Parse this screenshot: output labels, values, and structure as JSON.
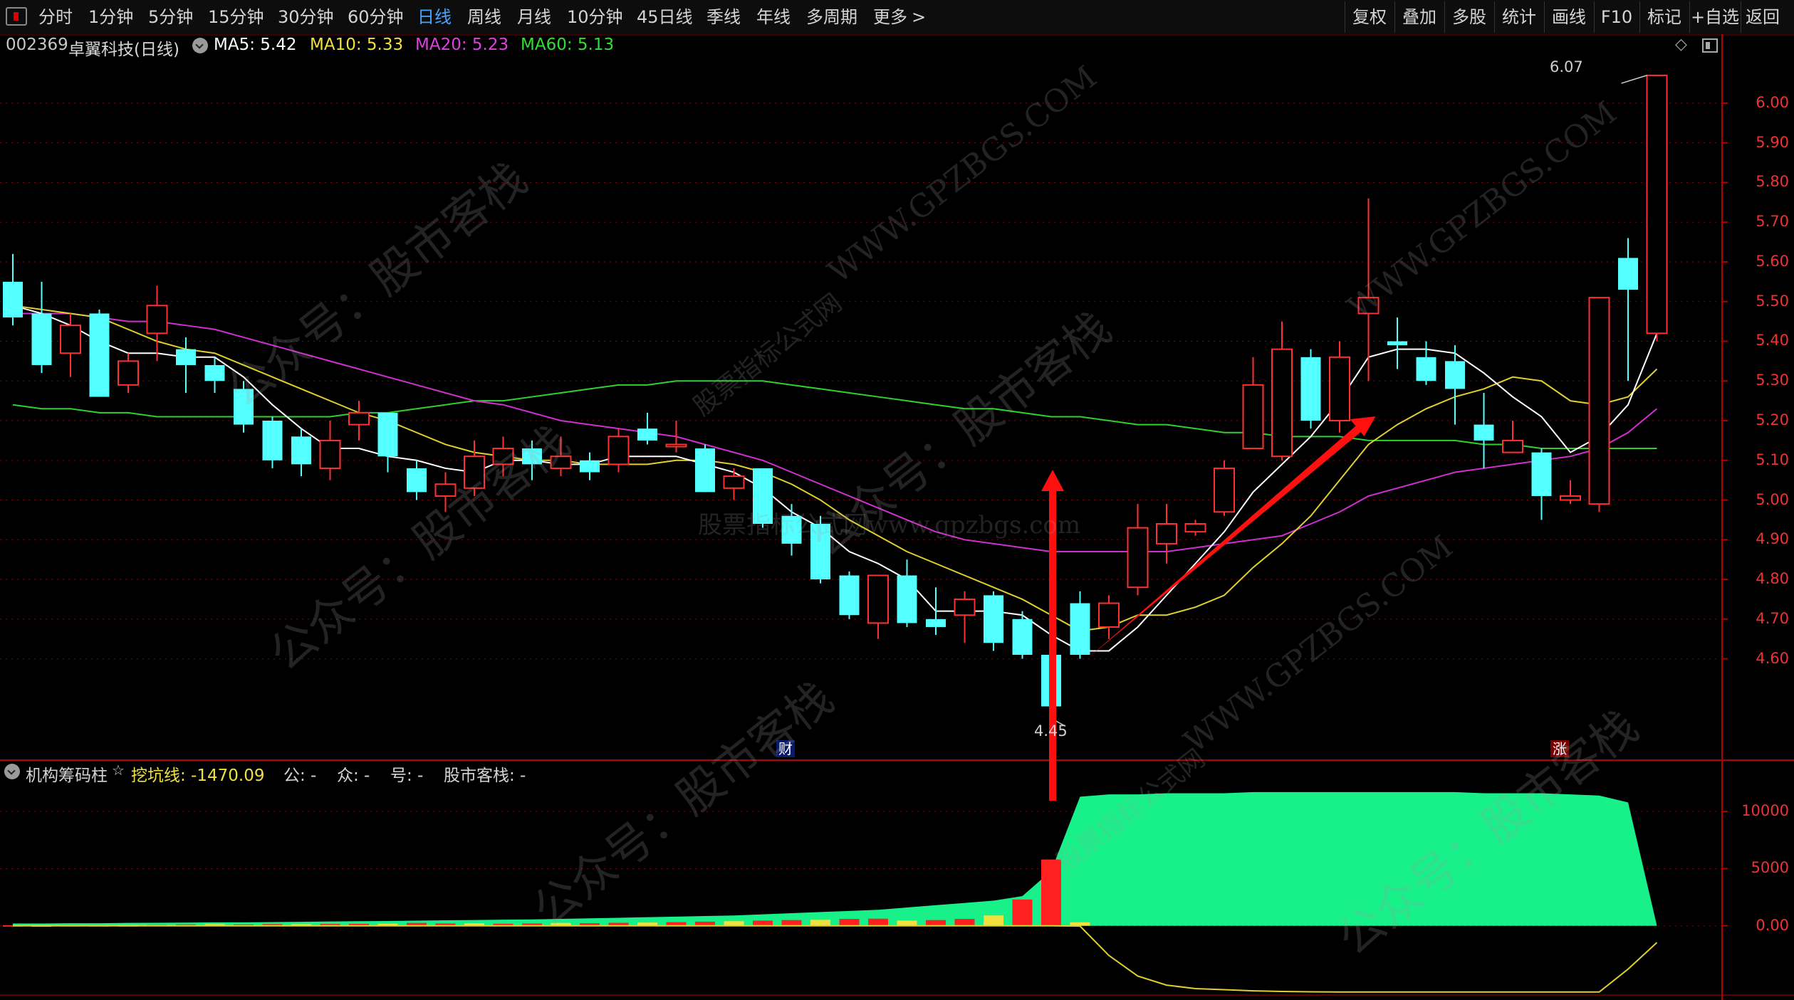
{
  "toolbar": {
    "periods": [
      "分时",
      "1分钟",
      "5分钟",
      "15分钟",
      "30分钟",
      "60分钟",
      "日线",
      "周线",
      "月线",
      "10分钟",
      "45日线",
      "季线",
      "年线",
      "多周期",
      "更多"
    ],
    "active_period": "日线",
    "right_buttons": [
      "复权",
      "叠加",
      "多股",
      "统计",
      "画线",
      "F10",
      "标记",
      "+自选",
      "返回"
    ]
  },
  "stock": {
    "code": "002369",
    "name": "卓翼科技(日线)",
    "ma": [
      {
        "label": "MA5: 5.42",
        "color": "#ffffff"
      },
      {
        "label": "MA10: 5.33",
        "color": "#f0e040"
      },
      {
        "label": "MA20: 5.23",
        "color": "#e040e0"
      },
      {
        "label": "MA60: 5.13",
        "color": "#30e030"
      }
    ]
  },
  "indicator": {
    "name": "机构筹码柱",
    "items": [
      {
        "label": "挖坑线: -1470.09",
        "color": "#f0e040"
      },
      {
        "label": "公: -",
        "color": "#d4d4d4"
      },
      {
        "label": "众: -",
        "color": "#d4d4d4"
      },
      {
        "label": "号: -",
        "color": "#d4d4d4"
      },
      {
        "label": "股市客栈: -",
        "color": "#d4d4d4"
      }
    ]
  },
  "price_axis": [
    "6.00",
    "5.90",
    "5.80",
    "5.70",
    "5.60",
    "5.50",
    "5.40",
    "5.30",
    "5.20",
    "5.10",
    "5.00",
    "4.90",
    "4.80",
    "4.70",
    "4.60"
  ],
  "ind_axis": [
    "10000",
    "5000",
    "0.00"
  ],
  "annotations": {
    "high": "6.07",
    "low": "4.45",
    "cai": "财",
    "zhang": "涨"
  },
  "watermarks": [
    "公众号：股市客栈",
    "WWW.GPZBGS.COM",
    "股票指标公式网",
    "股票指标公式网www.gpzbgs.com"
  ],
  "colors": {
    "up": "#ff3030",
    "down": "#54ffff",
    "grid": "#8b0000",
    "green_area": "#18f08a"
  },
  "chart_data": {
    "type": "candlestick",
    "candles": [
      {
        "o": 5.55,
        "c": 5.46,
        "h": 5.62,
        "l": 5.44
      },
      {
        "o": 5.47,
        "c": 5.34,
        "h": 5.55,
        "l": 5.32
      },
      {
        "o": 5.37,
        "c": 5.44,
        "h": 5.47,
        "l": 5.31
      },
      {
        "o": 5.47,
        "c": 5.26,
        "h": 5.48,
        "l": 5.26
      },
      {
        "o": 5.29,
        "c": 5.35,
        "h": 5.37,
        "l": 5.27
      },
      {
        "o": 5.42,
        "c": 5.49,
        "h": 5.54,
        "l": 5.35
      },
      {
        "o": 5.38,
        "c": 5.34,
        "h": 5.41,
        "l": 5.27
      },
      {
        "o": 5.34,
        "c": 5.3,
        "h": 5.36,
        "l": 5.27
      },
      {
        "o": 5.28,
        "c": 5.19,
        "h": 5.3,
        "l": 5.17
      },
      {
        "o": 5.2,
        "c": 5.1,
        "h": 5.21,
        "l": 5.08
      },
      {
        "o": 5.16,
        "c": 5.09,
        "h": 5.18,
        "l": 5.06
      },
      {
        "o": 5.08,
        "c": 5.15,
        "h": 5.2,
        "l": 5.05
      },
      {
        "o": 5.19,
        "c": 5.22,
        "h": 5.25,
        "l": 5.15
      },
      {
        "o": 5.22,
        "c": 5.11,
        "h": 5.22,
        "l": 5.07
      },
      {
        "o": 5.08,
        "c": 5.02,
        "h": 5.1,
        "l": 5.0
      },
      {
        "o": 5.01,
        "c": 5.04,
        "h": 5.07,
        "l": 4.97
      },
      {
        "o": 5.03,
        "c": 5.11,
        "h": 5.15,
        "l": 5.01
      },
      {
        "o": 5.09,
        "c": 5.13,
        "h": 5.16,
        "l": 5.06
      },
      {
        "o": 5.13,
        "c": 5.09,
        "h": 5.15,
        "l": 5.05
      },
      {
        "o": 5.08,
        "c": 5.11,
        "h": 5.16,
        "l": 5.06
      },
      {
        "o": 5.1,
        "c": 5.07,
        "h": 5.12,
        "l": 5.05
      },
      {
        "o": 5.09,
        "c": 5.16,
        "h": 5.18,
        "l": 5.07
      },
      {
        "o": 5.18,
        "c": 5.15,
        "h": 5.22,
        "l": 5.14
      },
      {
        "o": 5.14,
        "c": 5.14,
        "h": 5.2,
        "l": 5.12
      },
      {
        "o": 5.13,
        "c": 5.02,
        "h": 5.14,
        "l": 5.02
      },
      {
        "o": 5.03,
        "c": 5.06,
        "h": 5.08,
        "l": 5.0
      },
      {
        "o": 5.08,
        "c": 4.94,
        "h": 5.08,
        "l": 4.93
      },
      {
        "o": 4.96,
        "c": 4.89,
        "h": 4.99,
        "l": 4.86
      },
      {
        "o": 4.94,
        "c": 4.8,
        "h": 4.96,
        "l": 4.79
      },
      {
        "o": 4.81,
        "c": 4.71,
        "h": 4.82,
        "l": 4.7
      },
      {
        "o": 4.69,
        "c": 4.81,
        "h": 4.81,
        "l": 4.65
      },
      {
        "o": 4.81,
        "c": 4.69,
        "h": 4.85,
        "l": 4.68
      },
      {
        "o": 4.7,
        "c": 4.68,
        "h": 4.78,
        "l": 4.66
      },
      {
        "o": 4.71,
        "c": 4.75,
        "h": 4.77,
        "l": 4.64
      },
      {
        "o": 4.76,
        "c": 4.64,
        "h": 4.77,
        "l": 4.62
      },
      {
        "o": 4.7,
        "c": 4.61,
        "h": 4.72,
        "l": 4.6
      },
      {
        "o": 4.61,
        "c": 4.48,
        "h": 4.61,
        "l": 4.45
      },
      {
        "o": 4.74,
        "c": 4.61,
        "h": 4.77,
        "l": 4.6
      },
      {
        "o": 4.68,
        "c": 4.74,
        "h": 4.76,
        "l": 4.65
      },
      {
        "o": 4.78,
        "c": 4.93,
        "h": 4.99,
        "l": 4.76
      },
      {
        "o": 4.89,
        "c": 4.94,
        "h": 4.99,
        "l": 4.84
      },
      {
        "o": 4.92,
        "c": 4.94,
        "h": 4.95,
        "l": 4.91
      },
      {
        "o": 4.97,
        "c": 5.08,
        "h": 5.1,
        "l": 4.96
      },
      {
        "o": 5.13,
        "c": 5.29,
        "h": 5.36,
        "l": 5.13
      },
      {
        "o": 5.11,
        "c": 5.38,
        "h": 5.45,
        "l": 5.1
      },
      {
        "o": 5.36,
        "c": 5.2,
        "h": 5.38,
        "l": 5.18
      },
      {
        "o": 5.2,
        "c": 5.36,
        "h": 5.4,
        "l": 5.17
      },
      {
        "o": 5.47,
        "c": 5.51,
        "h": 5.76,
        "l": 5.3
      },
      {
        "o": 5.4,
        "c": 5.39,
        "h": 5.46,
        "l": 5.33
      },
      {
        "o": 5.36,
        "c": 5.3,
        "h": 5.4,
        "l": 5.29
      },
      {
        "o": 5.35,
        "c": 5.28,
        "h": 5.39,
        "l": 5.19
      },
      {
        "o": 5.19,
        "c": 5.15,
        "h": 5.27,
        "l": 5.08
      },
      {
        "o": 5.12,
        "c": 5.15,
        "h": 5.2,
        "l": 5.12
      },
      {
        "o": 5.12,
        "c": 5.01,
        "h": 5.13,
        "l": 4.95
      },
      {
        "o": 5.0,
        "c": 5.01,
        "h": 5.05,
        "l": 4.99
      },
      {
        "o": 4.99,
        "c": 5.51,
        "h": 5.51,
        "l": 4.97
      },
      {
        "o": 5.61,
        "c": 5.53,
        "h": 5.66,
        "l": 5.3
      },
      {
        "o": 5.42,
        "c": 6.07,
        "h": 6.07,
        "l": 5.4
      }
    ],
    "ma5": [
      5.49,
      5.47,
      5.44,
      5.4,
      5.37,
      5.37,
      5.36,
      5.36,
      5.31,
      5.24,
      5.18,
      5.13,
      5.13,
      5.11,
      5.1,
      5.08,
      5.07,
      5.1,
      5.1,
      5.09,
      5.09,
      5.11,
      5.11,
      5.11,
      5.09,
      5.07,
      5.03,
      4.97,
      4.93,
      4.87,
      4.84,
      4.8,
      4.72,
      4.72,
      4.72,
      4.71,
      4.66,
      4.62,
      4.62,
      4.68,
      4.76,
      4.84,
      4.92,
      5.02,
      5.09,
      5.16,
      5.25,
      5.36,
      5.38,
      5.38,
      5.37,
      5.32,
      5.26,
      5.21,
      5.12,
      5.16,
      5.24,
      5.42
    ],
    "ma10": [
      5.49,
      5.48,
      5.47,
      5.46,
      5.43,
      5.4,
      5.38,
      5.37,
      5.34,
      5.31,
      5.28,
      5.25,
      5.22,
      5.2,
      5.17,
      5.14,
      5.12,
      5.11,
      5.1,
      5.1,
      5.09,
      5.09,
      5.09,
      5.1,
      5.1,
      5.09,
      5.07,
      5.04,
      5.0,
      4.95,
      4.91,
      4.87,
      4.84,
      4.81,
      4.78,
      4.75,
      4.71,
      4.67,
      4.68,
      4.71,
      4.71,
      4.73,
      4.76,
      4.83,
      4.89,
      4.96,
      5.05,
      5.14,
      5.19,
      5.23,
      5.26,
      5.28,
      5.31,
      5.3,
      5.25,
      5.24,
      5.26,
      5.33
    ],
    "ma20": [
      5.47,
      5.47,
      5.47,
      5.46,
      5.45,
      5.45,
      5.44,
      5.43,
      5.41,
      5.39,
      5.37,
      5.35,
      5.33,
      5.31,
      5.29,
      5.27,
      5.25,
      5.24,
      5.22,
      5.2,
      5.19,
      5.18,
      5.17,
      5.16,
      5.14,
      5.12,
      5.1,
      5.07,
      5.04,
      5.01,
      4.98,
      4.95,
      4.92,
      4.9,
      4.89,
      4.88,
      4.87,
      4.87,
      4.87,
      4.87,
      4.87,
      4.88,
      4.89,
      4.9,
      4.91,
      4.94,
      4.97,
      5.01,
      5.03,
      5.05,
      5.07,
      5.08,
      5.09,
      5.1,
      5.11,
      5.13,
      5.17,
      5.23
    ],
    "ma60": [
      5.24,
      5.23,
      5.23,
      5.22,
      5.22,
      5.21,
      5.21,
      5.21,
      5.21,
      5.21,
      5.21,
      5.21,
      5.22,
      5.22,
      5.23,
      5.24,
      5.25,
      5.25,
      5.26,
      5.27,
      5.28,
      5.29,
      5.29,
      5.3,
      5.3,
      5.3,
      5.3,
      5.29,
      5.28,
      5.27,
      5.26,
      5.25,
      5.24,
      5.23,
      5.23,
      5.22,
      5.21,
      5.21,
      5.2,
      5.19,
      5.19,
      5.18,
      5.17,
      5.17,
      5.16,
      5.16,
      5.16,
      5.15,
      5.15,
      5.15,
      5.15,
      5.14,
      5.14,
      5.13,
      5.13,
      5.13,
      5.13,
      5.13
    ],
    "chip_area": [
      200,
      200,
      220,
      220,
      250,
      260,
      280,
      300,
      300,
      320,
      350,
      380,
      400,
      420,
      450,
      480,
      500,
      530,
      560,
      600,
      650,
      700,
      750,
      800,
      850,
      900,
      1000,
      1100,
      1200,
      1300,
      1400,
      1600,
      1800,
      2000,
      2200,
      2600,
      4800,
      11300,
      11500,
      11500,
      11600,
      11600,
      11600,
      11700,
      11700,
      11700,
      11700,
      11700,
      11700,
      11700,
      11700,
      11600,
      11600,
      11600,
      11500,
      11400,
      10800,
      0
    ],
    "chip_bars": [
      50,
      40,
      60,
      50,
      60,
      80,
      120,
      150,
      120,
      150,
      140,
      160,
      170,
      180,
      250,
      200,
      220,
      180,
      200,
      250,
      220,
      260,
      280,
      320,
      360,
      400,
      450,
      500,
      520,
      600,
      620,
      450,
      500,
      600,
      900,
      2300,
      5800,
      300,
      0,
      0,
      0,
      0,
      0,
      0,
      0,
      0,
      0,
      0,
      0,
      0,
      0,
      0,
      0,
      0,
      0,
      0,
      0,
      0
    ],
    "wakeng": [
      0,
      0,
      0,
      0,
      0,
      0,
      0,
      0,
      0,
      0,
      0,
      0,
      0,
      0,
      0,
      0,
      0,
      0,
      0,
      0,
      0,
      0,
      0,
      0,
      0,
      0,
      0,
      0,
      0,
      0,
      0,
      0,
      0,
      0,
      0,
      0,
      0,
      -30,
      -2600,
      -4400,
      -5200,
      -5500,
      -5600,
      -5700,
      -5750,
      -5780,
      -5800,
      -5800,
      -5800,
      -5800,
      -5800,
      -5800,
      -5800,
      -5800,
      -5800,
      -5800,
      -3800,
      -1470.09
    ],
    "price_range": [
      4.35,
      6.12
    ],
    "ind_range": [
      -6500,
      14500
    ]
  }
}
